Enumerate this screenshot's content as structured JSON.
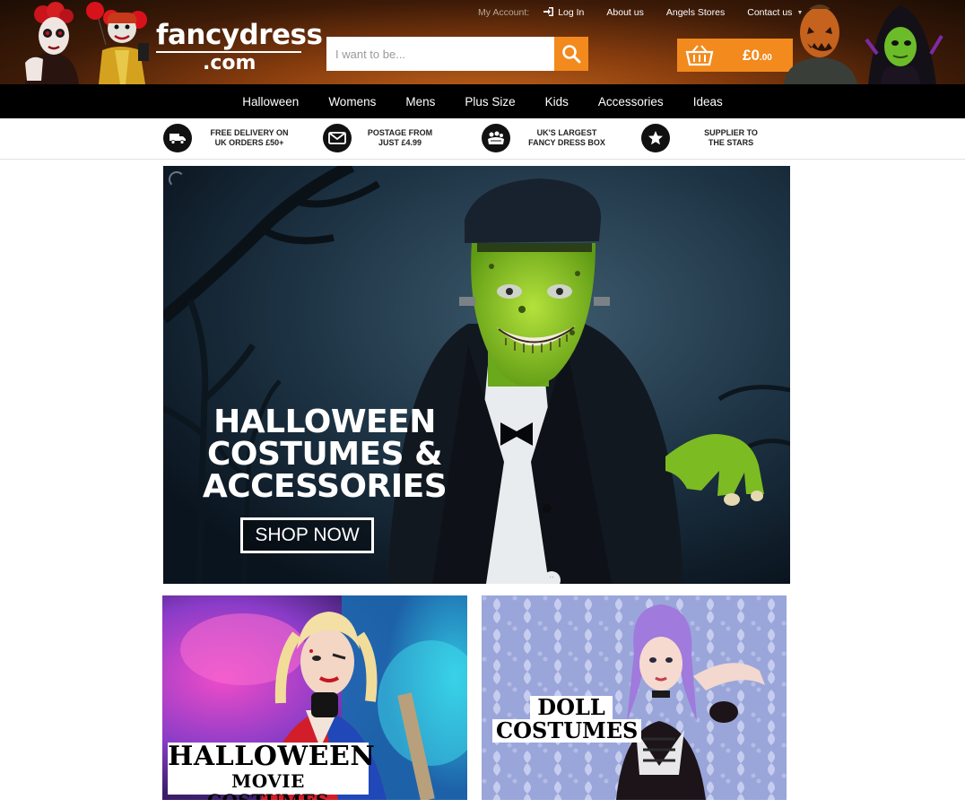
{
  "header": {
    "logo_main": "fancydress",
    "logo_sub": ".com",
    "my_account_label": "My Account:",
    "login_label": "Log In",
    "about_label": "About us",
    "stores_label": "Angels Stores",
    "contact_label": "Contact us",
    "search_placeholder": "I want to be...",
    "basket_amount": "£0",
    "basket_pence": ".00"
  },
  "nav": {
    "items": [
      "Halloween",
      "Womens",
      "Mens",
      "Plus Size",
      "Kids",
      "Accessories",
      "Ideas"
    ]
  },
  "usp": [
    {
      "icon": "truck-icon",
      "line1": "FREE DELIVERY ON",
      "line2": "UK ORDERS £50+"
    },
    {
      "icon": "envelope-icon",
      "line1": "POSTAGE FROM",
      "line2": "JUST £4.99"
    },
    {
      "icon": "costume-box-icon",
      "line1": "UK'S LARGEST",
      "line2": "FANCY DRESS BOX"
    },
    {
      "icon": "star-icon",
      "line1": "SUPPLIER TO",
      "line2": "THE STARS"
    }
  ],
  "hero": {
    "title_line1": "HALLOWEEN",
    "title_line2": "COSTUMES &",
    "title_line3": "ACCESSORIES",
    "button_label": "SHOP NOW",
    "slider_dot": "··"
  },
  "tiles": [
    {
      "line1": "HALLOWEEN",
      "line2": "MOVIE COSTUMES"
    },
    {
      "line1": "DOLL",
      "line2": "COSTUMES"
    }
  ],
  "colors": {
    "accent": "#f28a1e",
    "nav_bg": "#000000",
    "header_dark": "#1c0d04",
    "header_glow": "#c2641d"
  }
}
